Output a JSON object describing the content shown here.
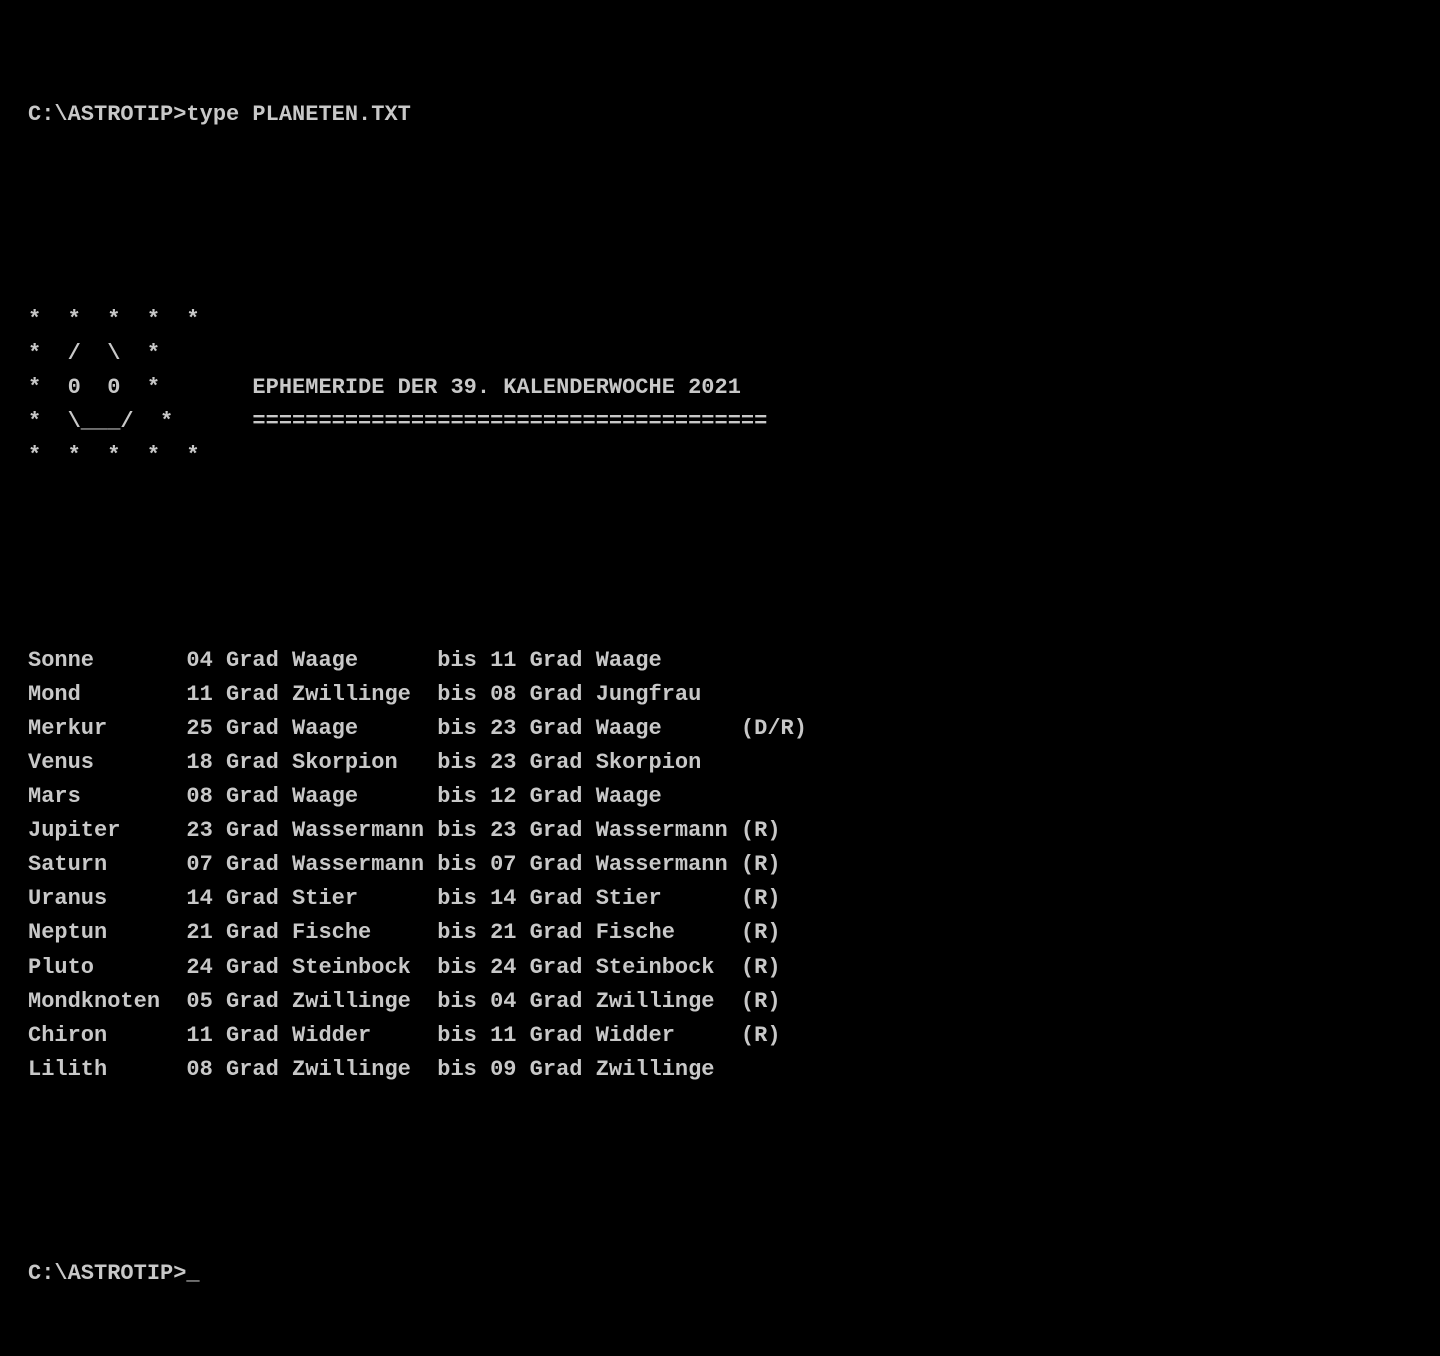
{
  "terminal": {
    "prompt_line": "C:\\ASTROTIP>type PLANETEN.TXT",
    "ascii_art": [
      "*  *  *  *  *",
      "*  /  \\  *",
      "*  0  0  *       EPHEMERIDE DER 39. KALENDERWOCHE 2021",
      "*  \\___/  *      =======================================",
      "*  *  *  *  *"
    ],
    "planets": [
      {
        "name": "Sonne",
        "deg_from": "04",
        "sign_from": "Waage",
        "bis": "bis",
        "deg_to": "11",
        "sign_to": "Waage",
        "retro": ""
      },
      {
        "name": "Mond",
        "deg_from": "11",
        "sign_from": "Zwillinge",
        "bis": "bis",
        "deg_to": "08",
        "sign_to": "Jungfrau",
        "retro": ""
      },
      {
        "name": "Merkur",
        "deg_from": "25",
        "sign_from": "Waage",
        "bis": "bis",
        "deg_to": "23",
        "sign_to": "Waage",
        "retro": "(D/R)"
      },
      {
        "name": "Venus",
        "deg_from": "18",
        "sign_from": "Skorpion",
        "bis": "bis",
        "deg_to": "23",
        "sign_to": "Skorpion",
        "retro": ""
      },
      {
        "name": "Mars",
        "deg_from": "08",
        "sign_from": "Waage",
        "bis": "bis",
        "deg_to": "12",
        "sign_to": "Waage",
        "retro": ""
      },
      {
        "name": "Jupiter",
        "deg_from": "23",
        "sign_from": "Wassermann",
        "bis": "bis",
        "deg_to": "23",
        "sign_to": "Wassermann",
        "retro": "(R)"
      },
      {
        "name": "Saturn",
        "deg_from": "07",
        "sign_from": "Wassermann",
        "bis": "bis",
        "deg_to": "07",
        "sign_to": "Wassermann",
        "retro": "(R)"
      },
      {
        "name": "Uranus",
        "deg_from": "14",
        "sign_from": "Stier",
        "bis": "bis",
        "deg_to": "14",
        "sign_to": "Stier",
        "retro": "(R)"
      },
      {
        "name": "Neptun",
        "deg_from": "21",
        "sign_from": "Fische",
        "bis": "bis",
        "deg_to": "21",
        "sign_to": "Fische",
        "retro": "(R)"
      },
      {
        "name": "Pluto",
        "deg_from": "24",
        "sign_from": "Steinbock",
        "bis": "bis",
        "deg_to": "24",
        "sign_to": "Steinbock",
        "retro": "(R)"
      },
      {
        "name": "Mondknoten",
        "deg_from": "05",
        "sign_from": "Zwillinge",
        "bis": "bis",
        "deg_to": "04",
        "sign_to": "Zwillinge",
        "retro": "(R)"
      },
      {
        "name": "Chiron",
        "deg_from": "11",
        "sign_from": "Widder",
        "bis": "bis",
        "deg_to": "11",
        "sign_to": "Widder",
        "retro": "(R)"
      },
      {
        "name": "Lilith",
        "deg_from": "08",
        "sign_from": "Zwillinge",
        "bis": "bis",
        "deg_to": "09",
        "sign_to": "Zwillinge",
        "retro": ""
      }
    ],
    "end_prompt": "C:\\ASTROTIP>_"
  }
}
